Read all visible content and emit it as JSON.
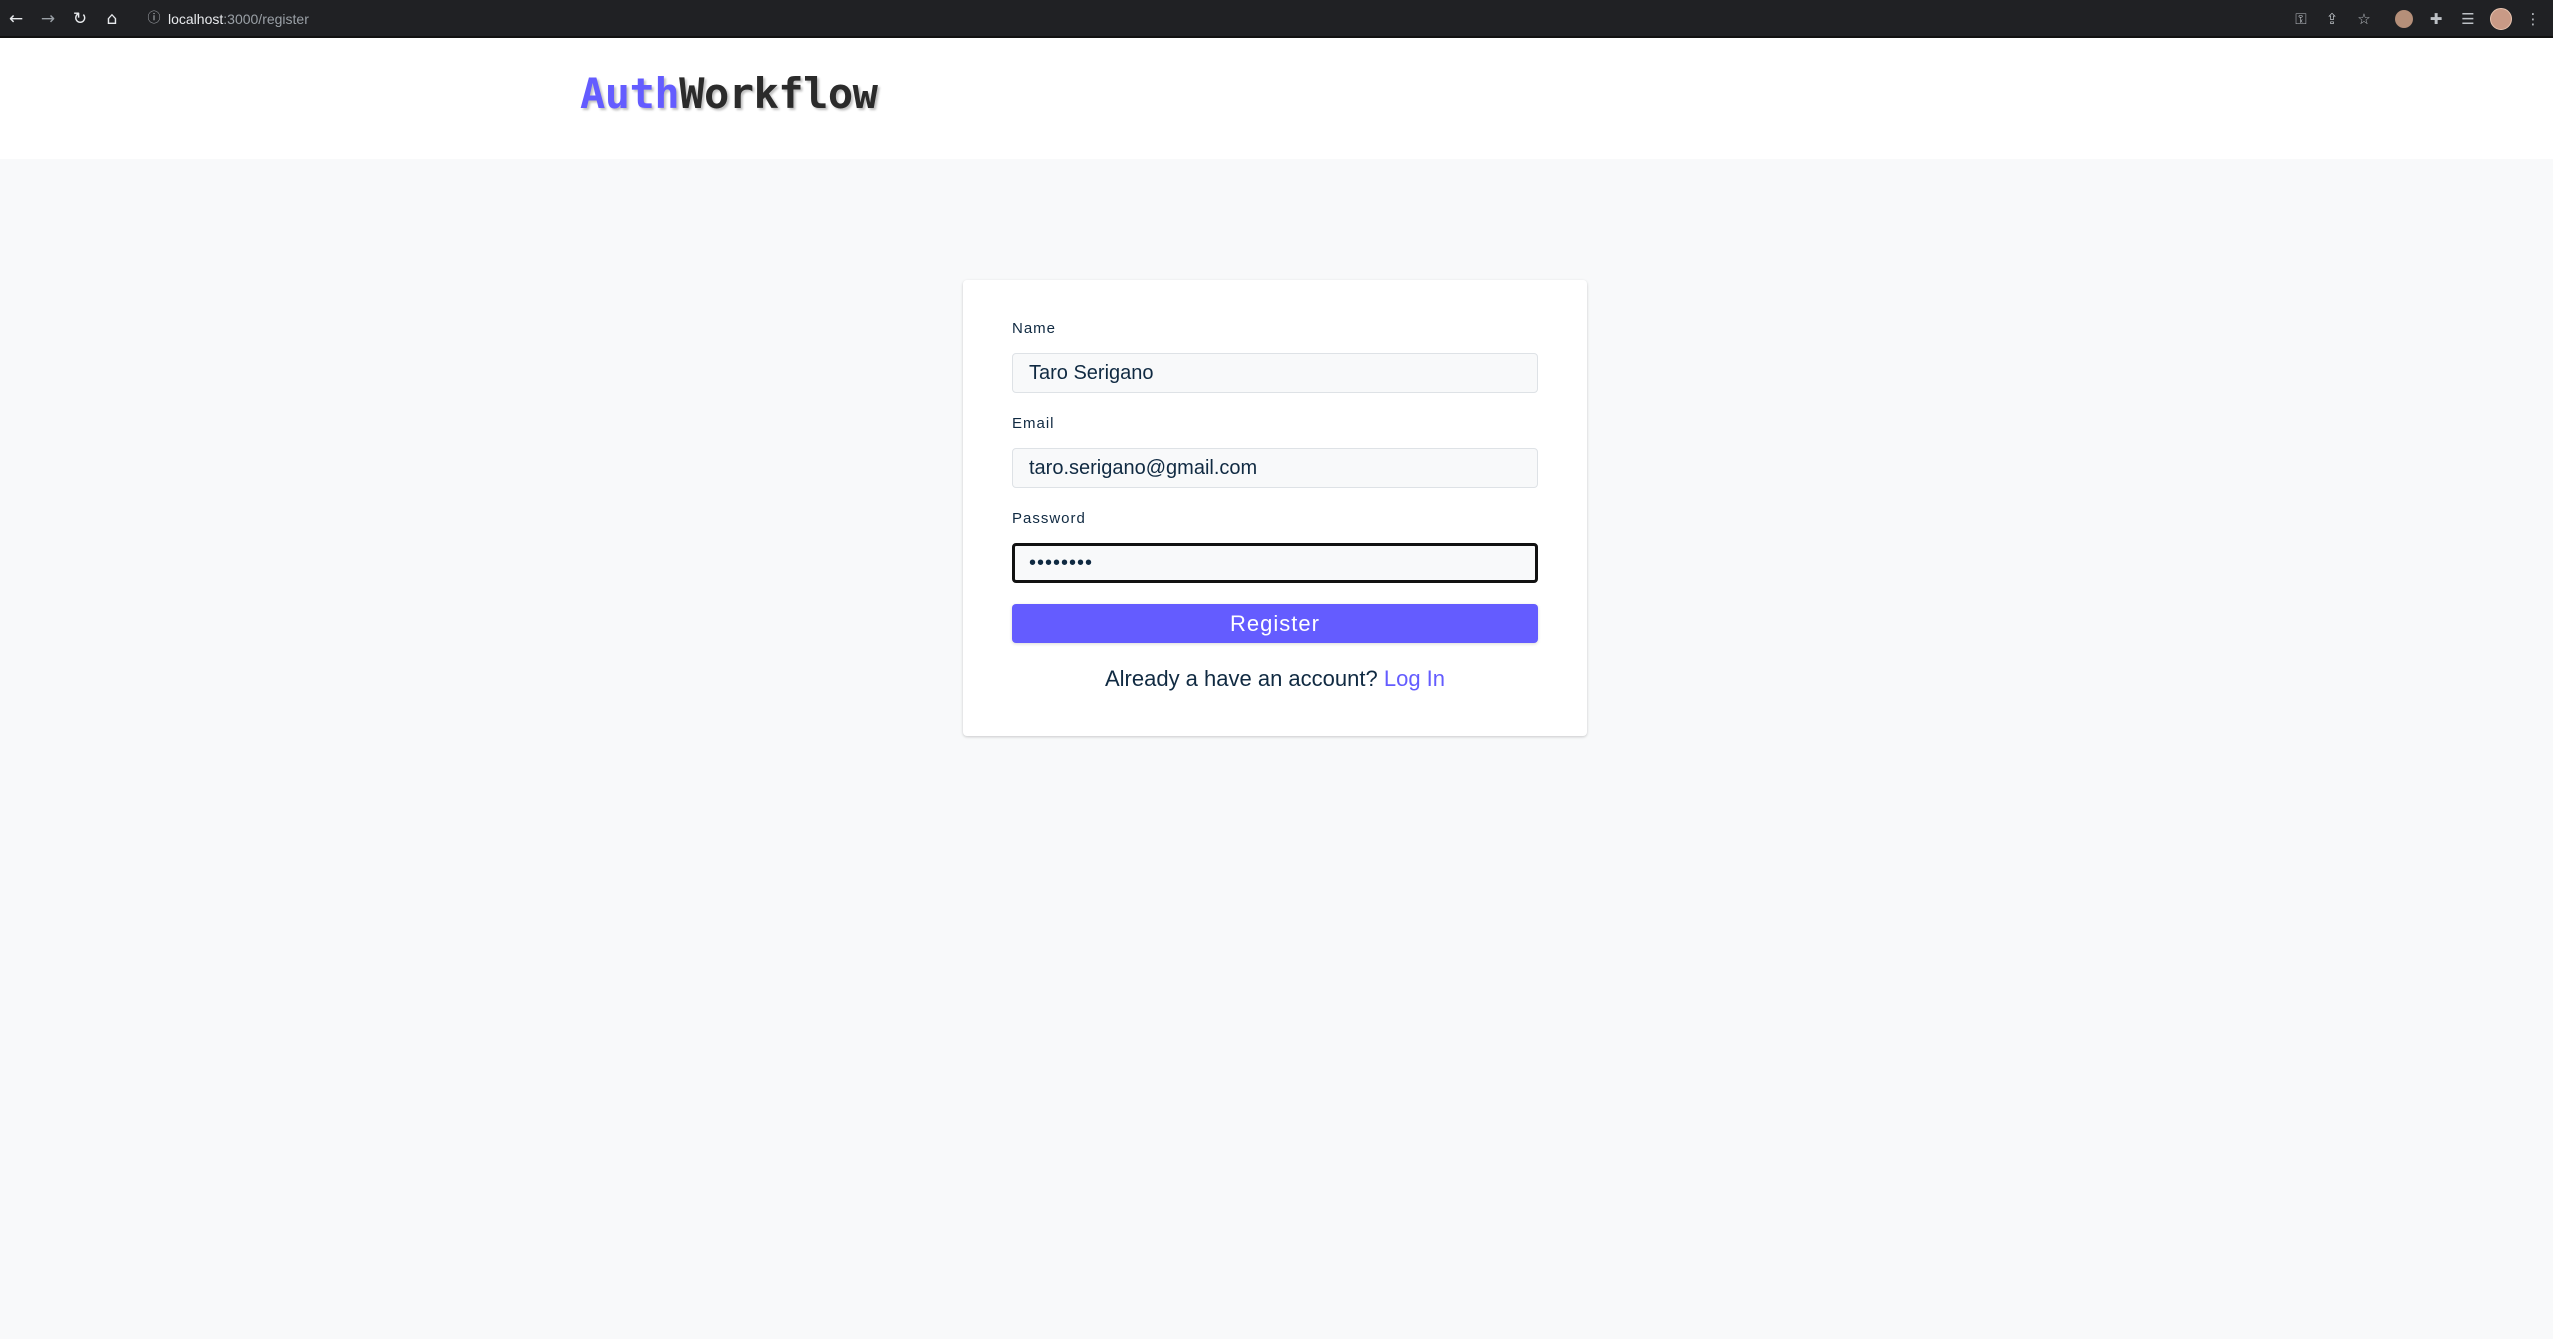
{
  "browser": {
    "url_host": "localhost",
    "url_rest": ":3000/register",
    "icons": {
      "back": "arrow-back-icon",
      "forward": "arrow-forward-icon",
      "reload": "reload-icon",
      "home": "home-icon",
      "site_info": "info-icon",
      "key": "key-icon",
      "share": "share-icon",
      "bookmark": "star-icon",
      "extensions": "puzzle-icon",
      "reading_list": "reading-list-icon",
      "menu": "kebab-menu-icon"
    }
  },
  "header": {
    "logo_part1": "Auth",
    "logo_part2": "Workflow"
  },
  "form": {
    "name_label": "Name",
    "name_value": "Taro Serigano",
    "email_label": "Email",
    "email_value": "taro.serigano@gmail.com",
    "password_label": "Password",
    "password_value": "••••••••",
    "submit_label": "Register",
    "member_text": "Already a have an account?",
    "login_link": "Log In"
  },
  "colors": {
    "primary": "#645cff",
    "page_background": "#f8f9fa",
    "browser_chrome": "#202124"
  }
}
